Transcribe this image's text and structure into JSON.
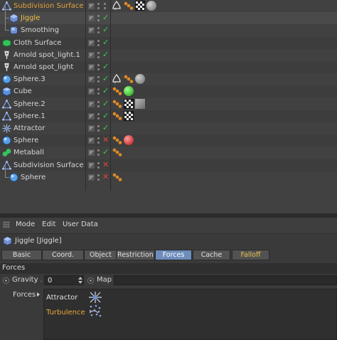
{
  "object_manager": {
    "rows": [
      {
        "label": "Subdivision Surface",
        "icon": "subdivision-surface-icon",
        "indent": 0,
        "color": "orange",
        "status": "dots",
        "tags": [
          "phong",
          "orange-dots",
          "checker",
          "gray-sphere"
        ]
      },
      {
        "label": "Jiggle",
        "icon": "jiggle-deformer-icon",
        "indent": 1,
        "color": "yellow",
        "status": "ok",
        "tags": []
      },
      {
        "label": "Smoothing",
        "icon": "smoothing-deformer-icon",
        "indent": 1,
        "color": "normal",
        "status": "ok",
        "tags": []
      },
      {
        "label": "Cloth Surface",
        "icon": "cloth-surface-icon",
        "indent": 0,
        "color": "normal",
        "status": "ok",
        "tags": []
      },
      {
        "label": "Arnold spot_light.1",
        "icon": "spot-light-icon",
        "indent": 0,
        "color": "normal",
        "status": "ok",
        "tags": []
      },
      {
        "label": "Arnold spot_light",
        "icon": "spot-light-icon",
        "indent": 0,
        "color": "normal",
        "status": "ok",
        "tags": []
      },
      {
        "label": "Sphere.3",
        "icon": "sphere-icon",
        "indent": 0,
        "color": "normal",
        "status": "ok",
        "tags": [
          "phong",
          "orange-dots",
          "gray-sphere"
        ]
      },
      {
        "label": "Cube",
        "icon": "cube-icon",
        "indent": 0,
        "color": "normal",
        "status": "ok",
        "tags": [
          "orange-dots",
          "green-sphere"
        ]
      },
      {
        "label": "Sphere.2",
        "icon": "subdivision-surface-icon",
        "indent": 0,
        "color": "normal",
        "status": "ok",
        "tags": [
          "orange-dots",
          "checker",
          "gray-square"
        ]
      },
      {
        "label": "Sphere.1",
        "icon": "subdivision-surface-icon",
        "indent": 0,
        "color": "normal",
        "status": "ok",
        "tags": [
          "orange-dots",
          "checker"
        ]
      },
      {
        "label": "Attractor",
        "icon": "attractor-icon",
        "indent": 0,
        "color": "normal",
        "status": "ok",
        "tags": []
      },
      {
        "label": "Sphere",
        "icon": "sphere-icon",
        "indent": 0,
        "color": "normal",
        "status": "off",
        "tags": [
          "orange-dots",
          "red-sphere"
        ]
      },
      {
        "label": "Metaball",
        "icon": "metaball-icon",
        "indent": 0,
        "color": "normal",
        "status": "ok",
        "tags": [
          "orange-dots"
        ]
      },
      {
        "label": "Subdivision Surface",
        "icon": "subdivision-surface-icon",
        "indent": 0,
        "color": "normal",
        "status": "off",
        "tags": []
      },
      {
        "label": "Sphere",
        "icon": "sphere-icon",
        "indent": 1,
        "color": "normal",
        "status": "off",
        "tags": [
          "orange-dots"
        ]
      }
    ]
  },
  "attribute_manager": {
    "menu": {
      "mode": "Mode",
      "edit": "Edit",
      "user_data": "User Data"
    },
    "object_title": "Jiggle [Jiggle]",
    "tabs": [
      {
        "label": "Basic",
        "active": false
      },
      {
        "label": "Coord.",
        "active": false
      },
      {
        "label": "Object",
        "active": false
      },
      {
        "label": "Restriction",
        "active": false
      },
      {
        "label": "Forces",
        "active": true
      },
      {
        "label": "Cache",
        "active": false
      },
      {
        "label": "Falloff",
        "active": false
      }
    ],
    "group_title": "Forces",
    "gravity": {
      "label": "Gravity",
      "dots": ". . .",
      "value": "0"
    },
    "map": {
      "label": "Map"
    },
    "forces": {
      "label": "Forces",
      "items": [
        {
          "label": "Attractor",
          "icon": "attractor-icon",
          "color": "white"
        },
        {
          "label": "Turbulence",
          "icon": "turbulence-icon",
          "color": "orange"
        }
      ]
    }
  },
  "colors": {
    "accent_tab": "#6d8dbc",
    "orange_text": "#e2a23b",
    "ok": "#39d24a",
    "off": "#e0453a"
  }
}
